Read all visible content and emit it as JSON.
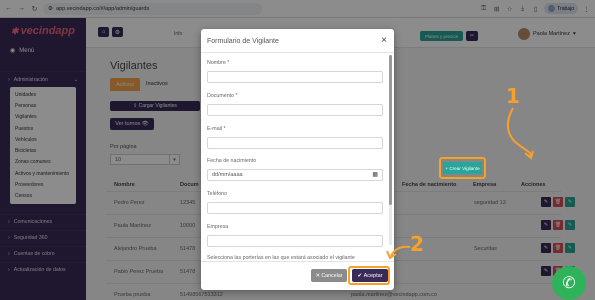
{
  "browser": {
    "url": "app.vecindapp.co/#/app/admin/guards",
    "profile": "Trabajo"
  },
  "sidebar": {
    "logo": "vecindapp",
    "menu_label": "Menú",
    "sections": [
      {
        "label": "Administración"
      },
      {
        "label": "Comunicaciones"
      },
      {
        "label": "Seguridad 360"
      },
      {
        "label": "Cuentas de cobro"
      },
      {
        "label": "Actualización de datos"
      }
    ],
    "submenu": [
      "Unidades",
      "Personas",
      "Vigilantes",
      "Puestos",
      "Vehículos",
      "Bicicletas",
      "Zonas comunes",
      "Activos y mantenimiento",
      "Proveedores",
      "Censos"
    ]
  },
  "topbar": {
    "info": "Info",
    "plans_button": "Planes y precios",
    "user_name": "Paola Martínez"
  },
  "main": {
    "title": "Vigilantes",
    "tabs": [
      "Activos",
      "Inactivos"
    ],
    "upload_button": "Cargar Vigilantes",
    "shifts_button": "Ver turnos",
    "per_page_label": "Por página",
    "per_page_value": "10",
    "create_button": "+ Crear Vigilante",
    "columns": [
      "Nombre",
      "Docum",
      "Fecha de nacimiento",
      "Empresa",
      "Acciones"
    ],
    "rows": [
      {
        "name": "Pedro Perez",
        "doc": "12345",
        "company": "seguridad 13"
      },
      {
        "name": "Paula Martínez",
        "doc": "10000",
        "company": ""
      },
      {
        "name": "Alejandro Prueba",
        "doc": "51478",
        "company": "Securitas"
      },
      {
        "name": "Pablo Perez Prueba",
        "doc": "51478",
        "company": ""
      },
      {
        "name": "Prueba prueba",
        "doc": "51498567513312",
        "company": "paola.martinez@vecindapp.com.co"
      }
    ]
  },
  "modal": {
    "title": "Formulario de Vigilante",
    "close": "×",
    "fields": [
      {
        "label": "Nombre *",
        "value": ""
      },
      {
        "label": "Documento *",
        "value": ""
      },
      {
        "label": "E-mail *",
        "value": ""
      },
      {
        "label": "Fecha de nacimiento",
        "value": "dd/mm/aaaa"
      },
      {
        "label": "Teléfono",
        "value": ""
      },
      {
        "label": "Empresa",
        "value": ""
      }
    ],
    "porterias_label": "Selecciona las porterías en las que estará asociado el vigilante",
    "cancel_button": "Cancelar",
    "accept_button": "Aceptar"
  },
  "annotations": {
    "step1": "1",
    "step2": "2",
    "highlight_color": "#f7a12b"
  },
  "colors": {
    "primary": "#3a2a57",
    "accent": "#f6a04a",
    "teal": "#2aa59a",
    "danger": "#d64e58"
  }
}
